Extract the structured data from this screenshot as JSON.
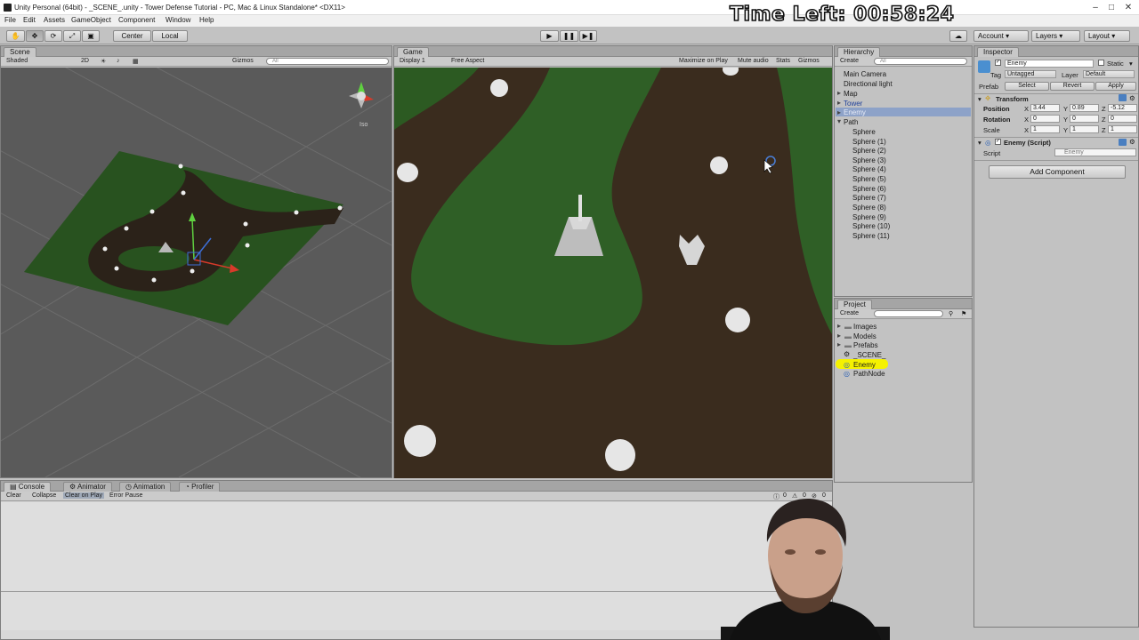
{
  "window": {
    "title": "Unity Personal (64bit) - _SCENE_.unity - Tower Defense Tutorial - PC, Mac & Linux Standalone* <DX11>"
  },
  "menu": [
    "File",
    "Edit",
    "Assets",
    "GameObject",
    "Component",
    "Window",
    "Help"
  ],
  "toolbar": {
    "pivot": "Center",
    "space": "Local",
    "account": "Account",
    "layers": "Layers",
    "layout": "Layout"
  },
  "timer_overlay": "Time Left: 00:58:24",
  "scene_view": {
    "tab": "Scene",
    "shading": "Shaded",
    "mode_2d": "2D",
    "gizmos": "Gizmos",
    "search_placeholder": "All",
    "projection": "Iso"
  },
  "game_view": {
    "tab": "Game",
    "display": "Display 1",
    "aspect": "Free Aspect",
    "maximize": "Maximize on Play",
    "mute": "Mute audio",
    "stats": "Stats",
    "gizmos": "Gizmos"
  },
  "hierarchy": {
    "tab": "Hierarchy",
    "create": "Create",
    "search_placeholder": "All",
    "items": [
      {
        "label": "Main Camera"
      },
      {
        "label": "Directional light"
      },
      {
        "label": "Map"
      },
      {
        "label": "Tower"
      },
      {
        "label": "Enemy"
      },
      {
        "label": "Path"
      },
      {
        "label": "Sphere"
      },
      {
        "label": "Sphere (1)"
      },
      {
        "label": "Sphere (2)"
      },
      {
        "label": "Sphere (3)"
      },
      {
        "label": "Sphere (4)"
      },
      {
        "label": "Sphere (5)"
      },
      {
        "label": "Sphere (6)"
      },
      {
        "label": "Sphere (7)"
      },
      {
        "label": "Sphere (8)"
      },
      {
        "label": "Sphere (9)"
      },
      {
        "label": "Sphere (10)"
      },
      {
        "label": "Sphere (11)"
      }
    ]
  },
  "project": {
    "tab": "Project",
    "create": "Create",
    "items": [
      {
        "label": "Images"
      },
      {
        "label": "Models"
      },
      {
        "label": "Prefabs"
      },
      {
        "label": "_SCENE_"
      },
      {
        "label": "Enemy"
      },
      {
        "label": "PathNode"
      }
    ]
  },
  "inspector": {
    "tab": "Inspector",
    "object_name": "Enemy",
    "static": "Static",
    "tag_label": "Tag",
    "tag_value": "Untagged",
    "layer_label": "Layer",
    "layer_value": "Default",
    "prefab_label": "Prefab",
    "prefab_select": "Select",
    "prefab_revert": "Revert",
    "prefab_apply": "Apply",
    "transform": {
      "title": "Transform",
      "position_label": "Position",
      "position": {
        "x": "3.44",
        "y": "0.89",
        "z": "-5.12"
      },
      "rotation_label": "Rotation",
      "rotation": {
        "x": "0",
        "y": "0",
        "z": "0"
      },
      "scale_label": "Scale",
      "scale": {
        "x": "1",
        "y": "1",
        "z": "1"
      }
    },
    "script_component": {
      "title": "Enemy (Script)",
      "script_label": "Script",
      "script_value": "Enemy"
    },
    "add_component": "Add Component"
  },
  "console": {
    "tabs": [
      "Console",
      "Animator",
      "Animation",
      "Profiler"
    ],
    "buttons": [
      "Clear",
      "Collapse",
      "Clear on Play",
      "Error Pause"
    ],
    "counts": [
      "0",
      "0",
      "0"
    ]
  },
  "colors": {
    "highlight": "#f5f200",
    "selection_blue": "#3d6fb8",
    "grass": "#2f5a26",
    "path": "#3a2c1e"
  }
}
